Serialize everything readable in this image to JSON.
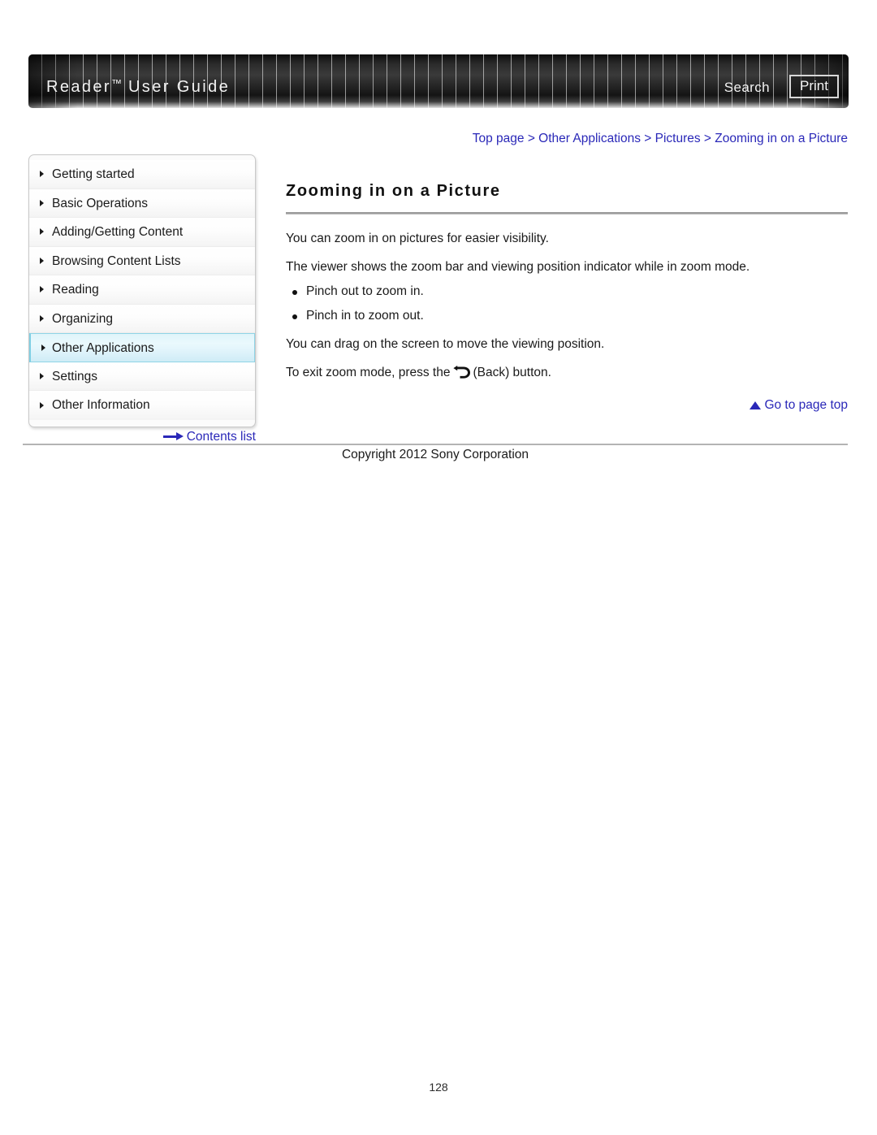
{
  "header": {
    "title": "Reader",
    "title_tm": "™",
    "title_rest": " User Guide",
    "search_label": "Search",
    "print_label": "Print"
  },
  "breadcrumb": {
    "items": [
      "Top page",
      "Other Applications",
      "Pictures",
      "Zooming in on a Picture"
    ],
    "separator": " > ",
    "full_text": "Top page > Other Applications > Pictures > Zooming in on a Picture"
  },
  "sidebar": {
    "items": [
      {
        "label": "Getting started",
        "active": false
      },
      {
        "label": "Basic Operations",
        "active": false
      },
      {
        "label": "Adding/Getting Content",
        "active": false
      },
      {
        "label": "Browsing Content Lists",
        "active": false
      },
      {
        "label": "Reading",
        "active": false
      },
      {
        "label": "Organizing",
        "active": false
      },
      {
        "label": "Other Applications",
        "active": true
      },
      {
        "label": "Settings",
        "active": false
      },
      {
        "label": "Other Information",
        "active": false
      }
    ],
    "contents_list_label": "Contents list"
  },
  "main": {
    "title": "Zooming in on a Picture",
    "paragraph_1": "You can zoom in on pictures for easier visibility.",
    "paragraph_2": "The viewer shows the zoom bar and viewing position indicator while in zoom mode.",
    "bullets": [
      "Pinch out to zoom in.",
      "Pinch in to zoom out."
    ],
    "paragraph_3": "You can drag on the screen to move the viewing position.",
    "paragraph_4_before": "To exit zoom mode, press the",
    "paragraph_4_after": "(Back) button.",
    "goto_top_label": "Go to page top"
  },
  "footer": {
    "copyright": "Copyright 2012 Sony Corporation",
    "page_number": "128"
  },
  "colors": {
    "link_blue": "#2a28b8",
    "active_item_bg": "#dff4fa",
    "active_item_border": "#8fd4e6",
    "rule_gray": "#9c9c9c"
  }
}
